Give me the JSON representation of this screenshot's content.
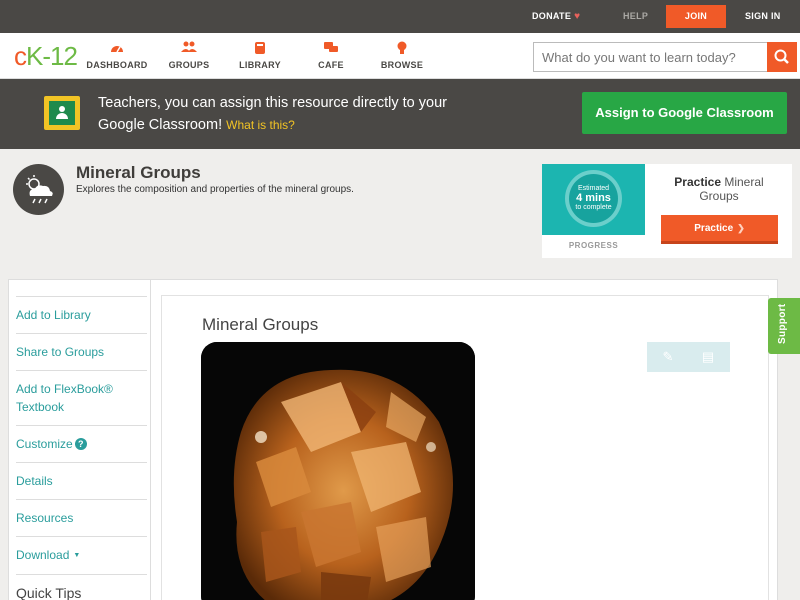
{
  "topbar": {
    "donate": "DONATE",
    "help": "HELP",
    "join": "JOIN",
    "signin": "SIGN IN"
  },
  "logo": {
    "c": "c",
    "k": "K",
    "dash": "-",
    "num": "12"
  },
  "nav": {
    "items": [
      {
        "label": "DASHBOARD",
        "icon": "dashboard-icon"
      },
      {
        "label": "GROUPS",
        "icon": "groups-icon"
      },
      {
        "label": "LIBRARY",
        "icon": "library-icon"
      },
      {
        "label": "CAFE",
        "icon": "cafe-icon"
      },
      {
        "label": "BROWSE",
        "icon": "browse-icon"
      }
    ],
    "search_placeholder": "What do you want to learn today?"
  },
  "banner": {
    "text": "Teachers, you can assign this resource directly to your Google Classroom!",
    "whatis": "What is this?",
    "assign": "Assign to Google Classroom"
  },
  "resource": {
    "title": "Mineral Groups",
    "description": "Explores the composition and properties of the mineral groups."
  },
  "practice": {
    "estimated": "Estimated",
    "mins": "4 mins",
    "complete": "to complete",
    "progress": "PROGRESS",
    "title_bold": "Practice",
    "title_rest": "Mineral Groups",
    "button": "Practice"
  },
  "sidebar": {
    "add_library": "Add to Library",
    "share_groups": "Share to Groups",
    "add_flexbook": "Add to FlexBook® Textbook",
    "customize": "Customize",
    "details": "Details",
    "resources": "Resources",
    "download": "Download",
    "quick_tips": "Quick Tips"
  },
  "content": {
    "title": "Mineral Groups"
  },
  "support": "Support",
  "colors": {
    "brand_orange": "#f05a28",
    "brand_green": "#6dba45",
    "teal_link": "#2a9d9c",
    "dark_bar": "#4a4845"
  }
}
